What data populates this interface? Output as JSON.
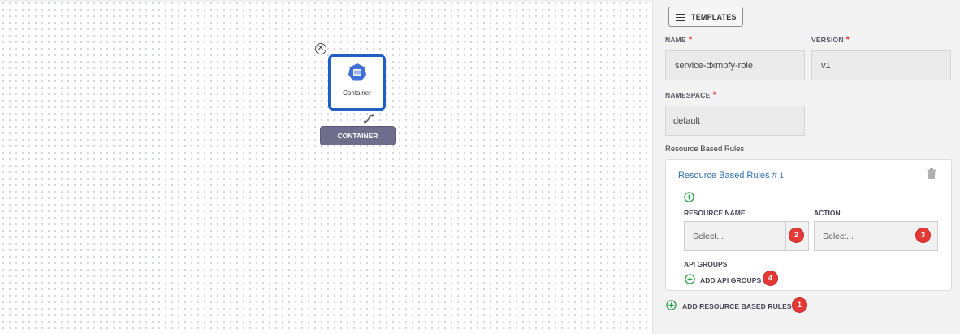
{
  "canvas": {
    "node": {
      "label": "Container",
      "tag": "CONTAINER",
      "border_color": "#1f5fc6",
      "icon": "kubernetes-container-icon"
    }
  },
  "panel": {
    "templates_label": "TEMPLATES",
    "name": {
      "label": "NAME",
      "required": "*",
      "value": "service-dxmpfy-role"
    },
    "version": {
      "label": "VERSION",
      "required": "*",
      "value": "v1"
    },
    "namespace": {
      "label": "NAMESPACE",
      "required": "*",
      "value": "default"
    },
    "section_title": "Resource Based Rules",
    "rules_card": {
      "title": "Resource Based Rules",
      "hash": "#",
      "index": "1",
      "resource_name": {
        "label": "RESOURCE NAME",
        "placeholder": "Select...",
        "badge": "2"
      },
      "action": {
        "label": "ACTION",
        "placeholder": "Select...",
        "badge": "3"
      },
      "api_groups": {
        "label": "API GROUPS",
        "add_label": "ADD API GROUPS",
        "badge": "4"
      }
    },
    "add_rules": {
      "label": "ADD RESOURCE BASED RULES",
      "badge": "1"
    }
  },
  "colors": {
    "accent_blue": "#2f6fb5",
    "add_green": "#2e9e4f",
    "badge_red": "#e53935",
    "required_red": "#e53935",
    "tag_gray": "#6e6e8c"
  }
}
